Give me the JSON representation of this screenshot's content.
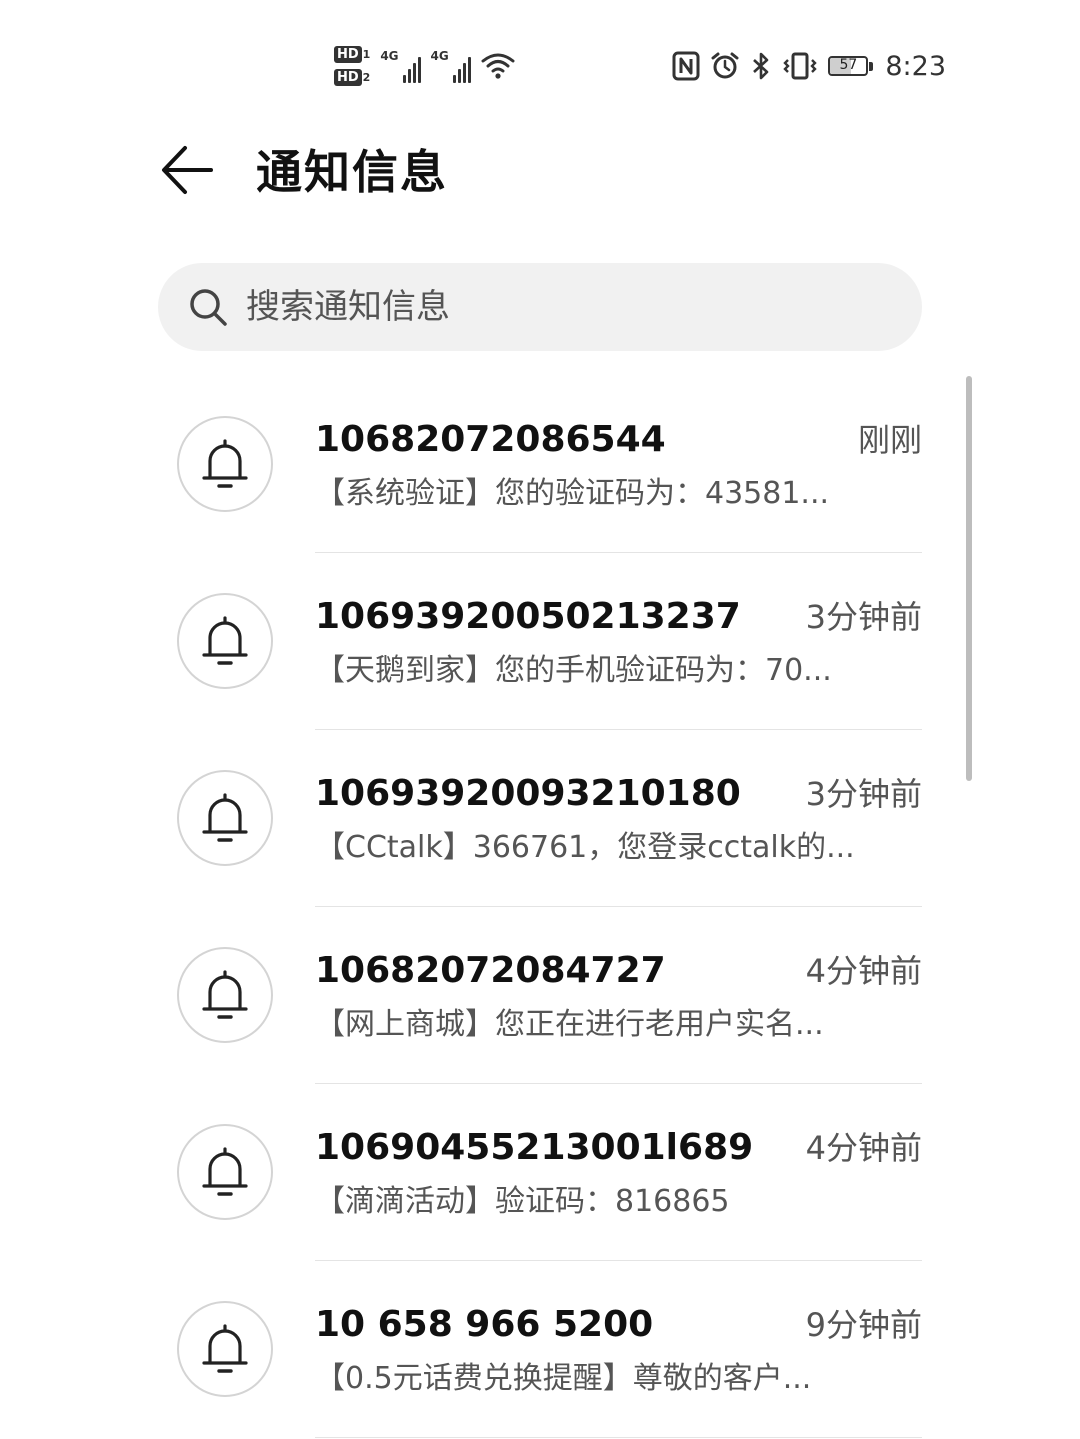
{
  "status_bar": {
    "sim1_label": "HD",
    "sim1_number": "1",
    "sim2_label": "HD",
    "sim2_number": "2",
    "network1": "4G",
    "network2": "4G",
    "battery_level": "57",
    "battery_fraction": 0.57,
    "time": "8:23",
    "icons": [
      "hd-sim1-icon",
      "hd-sim2-icon",
      "signal-4g-icon",
      "signal-4g-icon",
      "wifi-icon",
      "nfc-icon",
      "alarm-icon",
      "bluetooth-icon",
      "vibrate-icon",
      "battery-icon"
    ]
  },
  "header": {
    "title": "通知信息",
    "back_icon": "arrow-left-icon"
  },
  "search": {
    "placeholder": "搜索通知信息",
    "value": "",
    "icon": "search-icon"
  },
  "messages": [
    {
      "sender": "10682072086544",
      "time": "刚刚",
      "preview": "【系统验证】您的验证码为：43581...",
      "icon": "bell-icon"
    },
    {
      "sender": "10693920050213237",
      "time": "3分钟前",
      "preview": "【天鹅到家】您的手机验证码为：70...",
      "icon": "bell-icon"
    },
    {
      "sender": "10693920093210180",
      "time": "3分钟前",
      "preview": "【CCtalk】366761，您登录cctalk的...",
      "icon": "bell-icon"
    },
    {
      "sender": "10682072084727",
      "time": "4分钟前",
      "preview": "【网上商城】您正在进行老用户实名...",
      "icon": "bell-icon"
    },
    {
      "sender": "10690455213001l689",
      "time": "4分钟前",
      "preview": "【滴滴活动】验证码：816865",
      "icon": "bell-icon"
    },
    {
      "sender": "10 658 966 5200",
      "time": "9分钟前",
      "preview": "【0.5元话费兑换提醒】尊敬的客户...",
      "icon": "bell-icon"
    }
  ],
  "colors": {
    "background": "#ffffff",
    "search_bg": "#f1f1f1",
    "primary_text": "#111111",
    "secondary_text": "#555555",
    "divider": "#e4e4e4"
  }
}
